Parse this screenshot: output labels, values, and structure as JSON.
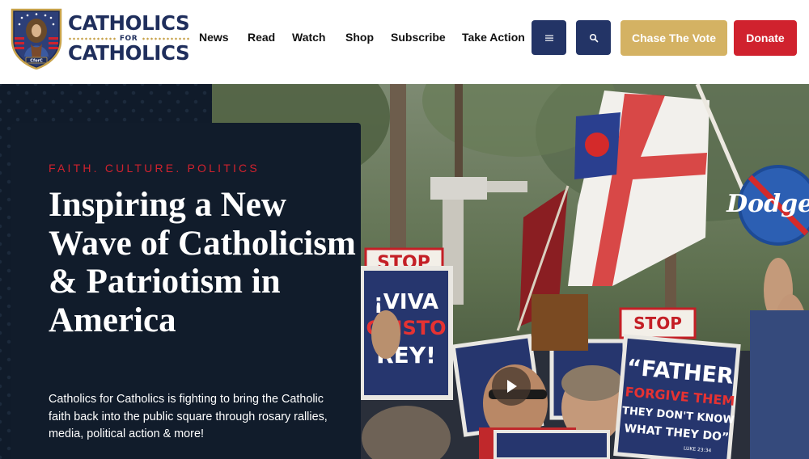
{
  "brand": {
    "line1": "CATHOLICS",
    "line2": "FOR",
    "line3": "CATHOLICS",
    "emblem": "CforC",
    "navy": "#1f2e5c",
    "gold": "#c7a24a",
    "red": "#d0222e"
  },
  "nav": {
    "items": [
      "News",
      "Read",
      "Watch",
      "Shop",
      "Subscribe",
      "Take Action"
    ]
  },
  "header": {
    "menu_icon": "hamburger-icon",
    "search_icon": "search-icon",
    "chase_label": "Chase The Vote",
    "donate_label": "Donate"
  },
  "hero": {
    "eyebrow": "FAITH. CULTURE. POLITICS",
    "headline": "Inspiring a New Wave of Catholicism & Patriotism in America",
    "blurb": "Catholics for Catholics is fighting to bring the Catholic faith back into the public square through rosary rallies, media, political action & more!",
    "play_icon": "play-icon",
    "signs": {
      "stop1": "STOP",
      "viva": "¡VIVA",
      "cristo": "CRISTO",
      "rey": "REY!",
      "father": "“FATHER",
      "forgive": "FORGIVE THEM",
      "they": "THEY DON'T KNOW",
      "what": "WHAT THEY DO”",
      "stop2": "STOP",
      "dodgers": "Dodgers",
      "luke": "LUKE 23:34"
    }
  }
}
